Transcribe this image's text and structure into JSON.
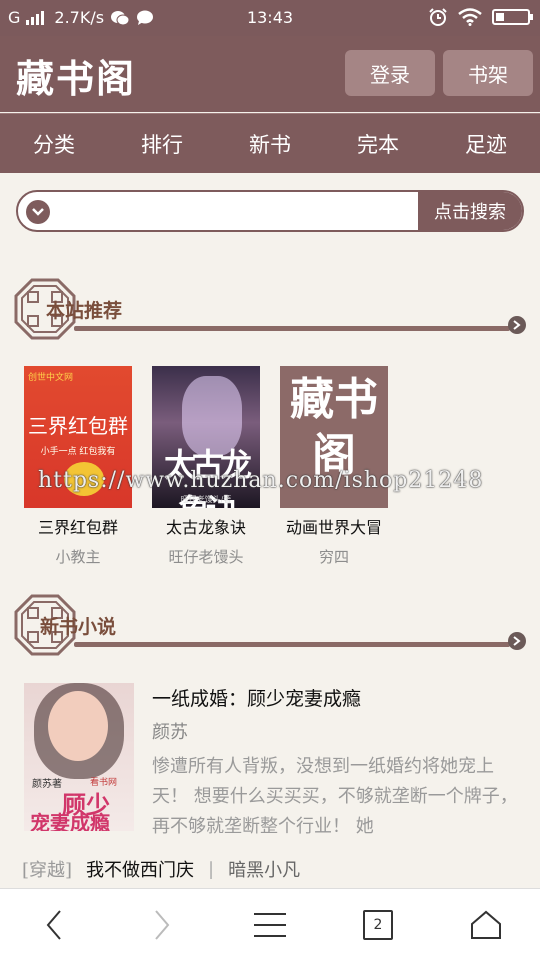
{
  "status_bar": {
    "carrier": "G",
    "speed": "2.7K/s",
    "time": "13:43",
    "icons": [
      "signal-icon",
      "wechat-icon",
      "chat-icon",
      "alarm-icon",
      "wifi-icon",
      "battery-icon"
    ]
  },
  "header": {
    "logo": "藏书阁",
    "login_label": "登录",
    "bookshelf_label": "书架"
  },
  "nav": {
    "items": [
      {
        "label": "分类"
      },
      {
        "label": "排行"
      },
      {
        "label": "新书"
      },
      {
        "label": "完本"
      },
      {
        "label": "足迹"
      }
    ]
  },
  "search": {
    "placeholder": "",
    "button_label": "点击搜索"
  },
  "recommend": {
    "title": "本站推荐",
    "books": [
      {
        "title": "三界红包群",
        "author": "小教主",
        "cover_text": "三界红包群",
        "cover_sub": "小手一点 红包我有",
        "cover_pub": "创世中文网"
      },
      {
        "title": "太古龙象诀",
        "author": "旺仔老馒头",
        "cover_text": "太古龙象诀",
        "cover_sub": "旺仔老馒头/著",
        "cover_pub": "创世中文网"
      },
      {
        "title": "动画世界大冒",
        "author": "穷四",
        "cover_text": "藏书阁"
      }
    ]
  },
  "watermark": "https://www.huzhan.com/ishop21248",
  "newbooks": {
    "title": "新书小说",
    "featured": {
      "title": "一纸成婚：顾少宠妻成瘾",
      "author": "颜苏",
      "description": "惨遭所有人背叛，没想到一纸婚约将她宠上天！ 想要什么买买买，不够就垄断一个牌子，再不够就垄断整个行业！ 她",
      "cover_author": "颜苏著",
      "cover_pub": "看书网",
      "cover_title_1": "顾少",
      "cover_title_2": "宠妻成瘾"
    },
    "list": [
      {
        "category": "[穿越]",
        "title": "我不做西门庆",
        "separator": "|",
        "author": "暗黑小凡"
      }
    ]
  },
  "bottom_bar": {
    "tab_count": "2",
    "icons": [
      "back-icon",
      "forward-icon",
      "menu-icon",
      "tabs-icon",
      "home-icon"
    ]
  }
}
